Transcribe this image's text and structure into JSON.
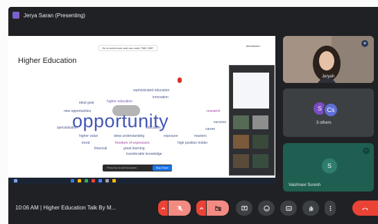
{
  "presenter": {
    "label": "Jerya Saran (Presenting)"
  },
  "slide": {
    "title": "Higher Education",
    "url_text": "Go to menti.com and use code  7382 3287",
    "logo_text": "Mentimeter",
    "big_word": "opportunity",
    "words": [
      "sophisticated education",
      "innovation",
      "ideal goal",
      "higher education",
      "new opportunities",
      "research",
      "specialization",
      "success",
      "higher value",
      "deep understanding",
      "exposure",
      "masters",
      "trend",
      "freedom of expression",
      "high position holder",
      "financial",
      "great learning",
      "transferable knowledge",
      "career",
      "education"
    ],
    "caption_placeholder": "Press Esc to exit full screen",
    "caption_button": "Stop Share"
  },
  "participants": [
    {
      "name": "Jeryah",
      "initial": ""
    },
    {
      "name": "3 others",
      "initials": [
        "S",
        "Cs"
      ]
    },
    {
      "name": "Vaishnavi Suresh",
      "initial": "S"
    }
  ],
  "footer": {
    "time": "10:06 AM",
    "meeting_title": "Higher Education Talk By M..."
  },
  "colors": {
    "accent_red": "#ea4335",
    "brand_blue": "#4457b6",
    "tile_teal": "#1f5f51"
  }
}
